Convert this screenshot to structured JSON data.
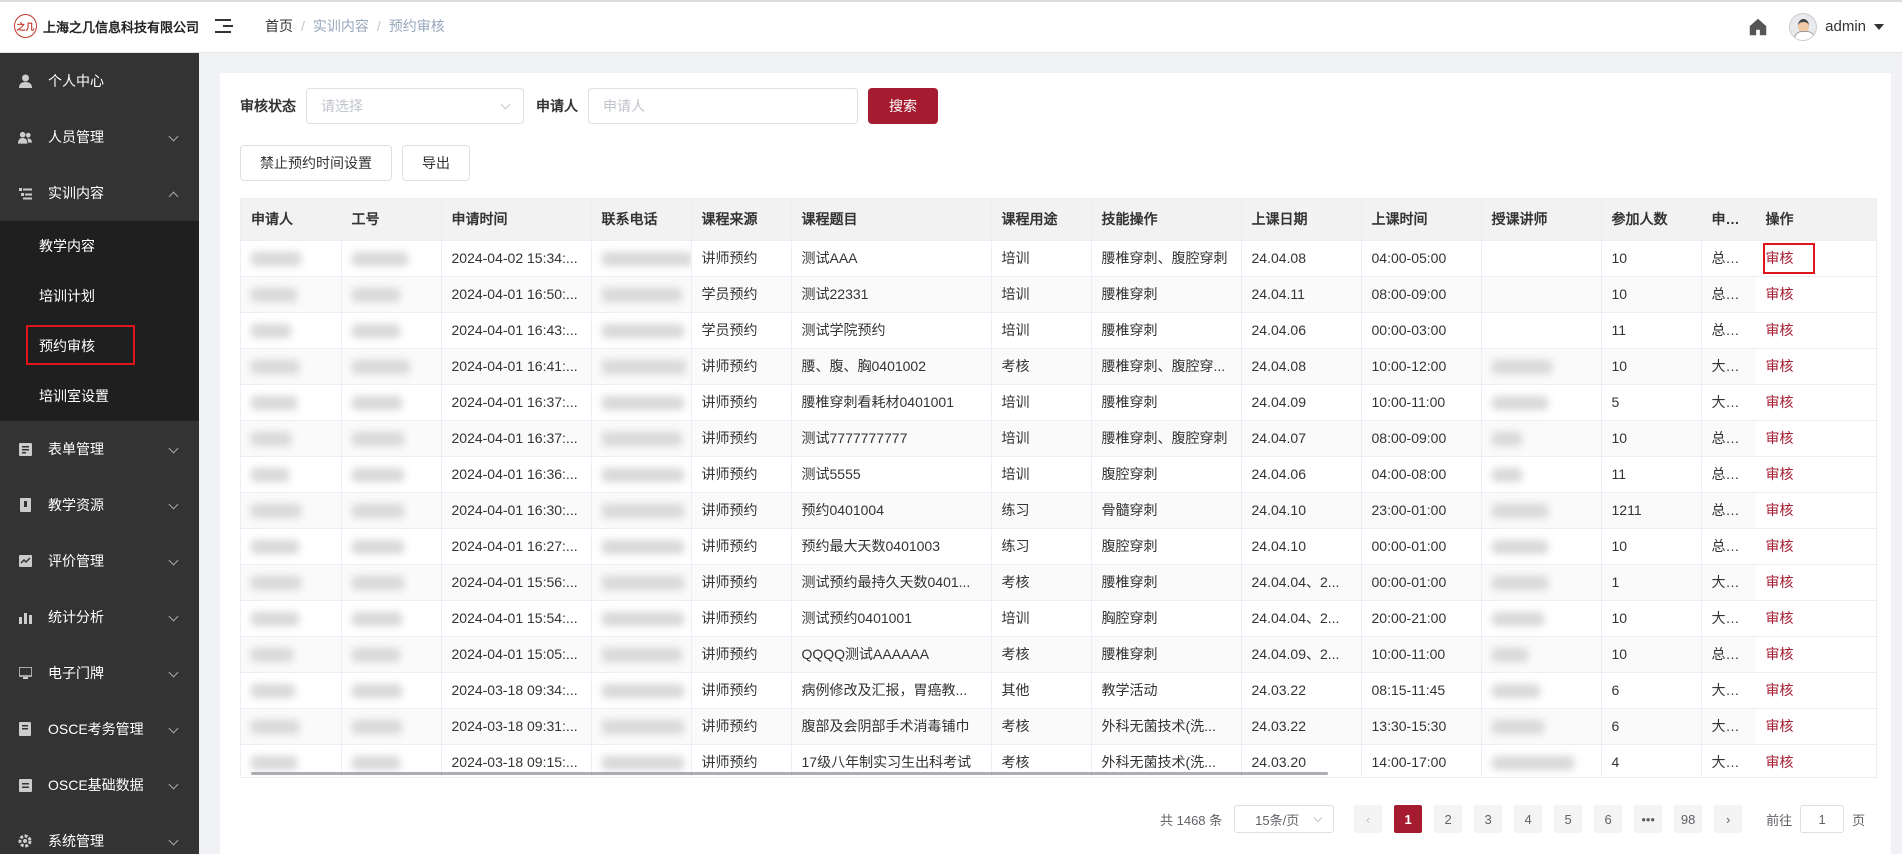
{
  "header": {
    "logo_mark": "之几",
    "logo_text": "上海之几信息科技有限公司",
    "breadcrumb": [
      "首页",
      "实训内容",
      "预约审核"
    ],
    "user_name": "admin"
  },
  "sidebar": {
    "items": [
      {
        "label": "个人中心",
        "icon": "person-icon"
      },
      {
        "label": "人员管理",
        "icon": "people-icon"
      },
      {
        "label": "实训内容",
        "icon": "list-icon",
        "expanded": true,
        "children": [
          "教学内容",
          "培训计划",
          "预约审核",
          "培训室设置"
        ]
      },
      {
        "label": "表单管理",
        "icon": "form-icon"
      },
      {
        "label": "教学资源",
        "icon": "resource-icon"
      },
      {
        "label": "评价管理",
        "icon": "evaluation-icon"
      },
      {
        "label": "统计分析",
        "icon": "bar-chart-icon"
      },
      {
        "label": "电子门牌",
        "icon": "monitor-icon"
      },
      {
        "label": "OSCE考务管理",
        "icon": "exam-icon"
      },
      {
        "label": "OSCE基础数据",
        "icon": "database-icon"
      },
      {
        "label": "系统管理",
        "icon": "gear-icon"
      }
    ],
    "active_child": "预约审核"
  },
  "filters": {
    "status_label": "审核状态",
    "status_placeholder": "请选择",
    "applicant_label": "申请人",
    "applicant_placeholder": "申请人",
    "search_button": "搜索"
  },
  "actions": {
    "forbid_button": "禁止预约时间设置",
    "export_button": "导出"
  },
  "table": {
    "columns": [
      "申请人",
      "工号",
      "申请时间",
      "联系电话",
      "课程来源",
      "课程题目",
      "课程用途",
      "技能操作",
      "上课日期",
      "上课时间",
      "授课讲师",
      "参加人数",
      "申请院区",
      "操作"
    ],
    "rows": [
      [
        "2024-04-02 15:34:...",
        "讲师预约",
        "测试AAA",
        "培训",
        "腰椎穿刺、腹腔穿刺",
        "24.04.08",
        "04:00-05:00",
        "10",
        "总部一期"
      ],
      [
        "2024-04-01 16:50:...",
        "学员预约",
        "测试22331",
        "培训",
        "腰椎穿刺",
        "24.04.11",
        "08:00-09:00",
        "10",
        "总部一期"
      ],
      [
        "2024-04-01 16:43:...",
        "学员预约",
        "测试学院预约",
        "培训",
        "腰椎穿刺",
        "24.04.06",
        "00:00-03:00",
        "11",
        "总部一期"
      ],
      [
        "2024-04-01 16:41:...",
        "讲师预约",
        "腰、腹、胸0401002",
        "考核",
        "腰椎穿刺、腹腔穿...",
        "24.04.08",
        "10:00-12:00",
        "10",
        "大学路院区"
      ],
      [
        "2024-04-01 16:37:...",
        "讲师预约",
        "腰椎穿刺看耗材0401001",
        "培训",
        "腰椎穿刺",
        "24.04.09",
        "10:00-11:00",
        "5",
        "大学路院区"
      ],
      [
        "2024-04-01 16:37:...",
        "讲师预约",
        "测试7777777777",
        "培训",
        "腰椎穿刺、腹腔穿刺",
        "24.04.07",
        "08:00-09:00",
        "10",
        "总部一期"
      ],
      [
        "2024-04-01 16:36:...",
        "讲师预约",
        "测试5555",
        "培训",
        "腹腔穿刺",
        "24.04.06",
        "04:00-08:00",
        "11",
        "总部一期"
      ],
      [
        "2024-04-01 16:30:...",
        "讲师预约",
        "预约0401004",
        "练习",
        "骨髓穿刺",
        "24.04.10",
        "23:00-01:00",
        "1211",
        "总部一期"
      ],
      [
        "2024-04-01 16:27:...",
        "讲师预约",
        "预约最大天数0401003",
        "练习",
        "腹腔穿刺",
        "24.04.10",
        "00:00-01:00",
        "10",
        "总部一期"
      ],
      [
        "2024-04-01 15:56:...",
        "讲师预约",
        "测试预约最持久天数0401...",
        "考核",
        "腰椎穿刺",
        "24.04.04、2...",
        "00:00-01:00",
        "1",
        "大学路院区"
      ],
      [
        "2024-04-01 15:54:...",
        "讲师预约",
        "测试预约0401001",
        "培训",
        "胸腔穿刺",
        "24.04.04、2...",
        "20:00-21:00",
        "10",
        "大学路院区"
      ],
      [
        "2024-04-01 15:05:...",
        "讲师预约",
        "QQQQ测试AAAAAA",
        "考核",
        "腰椎穿刺",
        "24.04.09、2...",
        "10:00-11:00",
        "10",
        "总部一期"
      ],
      [
        "2024-03-18 09:34:...",
        "讲师预约",
        "病例修改及汇报，胃癌教...",
        "其他",
        "教学活动",
        "24.03.22",
        "08:15-11:45",
        "6",
        "大学路院区"
      ],
      [
        "2024-03-18 09:31:...",
        "讲师预约",
        "腹部及会阴部手术消毒铺巾",
        "考核",
        "外科无菌技术(洗...",
        "24.03.22",
        "13:30-15:30",
        "6",
        "大学路院区"
      ],
      [
        "2024-03-18 09:15:...",
        "讲师预约",
        "17级八年制实习生出科考试",
        "考核",
        "外科无菌技术(洗...",
        "24.03.20",
        "14:00-17:00",
        "4",
        "大学路院区"
      ]
    ],
    "op_label": "审核"
  },
  "pagination": {
    "total_text": "共 1468 条",
    "page_size": "15条/页",
    "pages": [
      "1",
      "2",
      "3",
      "4",
      "5",
      "6",
      "•••",
      "98"
    ],
    "current": "1",
    "prev": "‹",
    "next": "›",
    "jump_prefix": "前往",
    "jump_value": "1",
    "jump_suffix": "页"
  },
  "colors": {
    "sidebar_bg": "#333333",
    "submenu_bg": "#1f1f1f",
    "primary": "#a51c30",
    "highlight_box": "#e0151b"
  }
}
